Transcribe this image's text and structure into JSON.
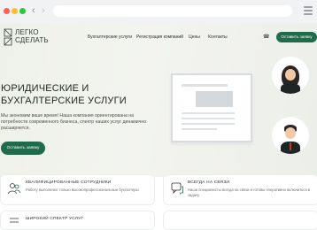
{
  "browser": {
    "colors": {
      "close": "#ff5f57",
      "minimize": "#febc2e",
      "maximize": "#28c840"
    },
    "back_icon": "chevron-left",
    "forward_icon": "chevron-right",
    "menu_icon": "hamburger"
  },
  "logo": {
    "line1": "ЛЕГКО",
    "line2": "СДЕЛАТЬ"
  },
  "nav": {
    "items": [
      "Бухгалтерские услуги",
      "Регистрация компаний",
      "Цены",
      "Контакты"
    ],
    "phone_icon": "phone",
    "cta_label": "Оставить заявку"
  },
  "hero": {
    "title_line1": "ЮРИДИЧЕСКИЕ И",
    "title_line2": "БУХГАЛТЕРСКИЕ УСЛУГИ",
    "description": "Мы экономим ваше время! Наша компания ориентирована на потребности современного бизнеса, спектр наших услуг динамично расширяется.",
    "cta_label": "Оставить заявку"
  },
  "features": [
    {
      "icon": "people-icon",
      "title": "КВАЛИФИЦИРОВАННЫЕ СОТРУДНИКИ",
      "text": "Работу выполняют только высокопрофессиональные бухгалтеры"
    },
    {
      "icon": "chat-icon",
      "title": "ВСЕГДА НА СВЯЗИ",
      "text": "Наши специалисты всегда на связи и готовы оперативно включиться в задачу"
    },
    {
      "icon": "list-icon",
      "title": "ШИРОКИЙ СПЕКТР УСЛУГ",
      "text": ""
    }
  ],
  "colors": {
    "accent": "#1f6b4a",
    "hero_bg": "#eef1e8"
  }
}
